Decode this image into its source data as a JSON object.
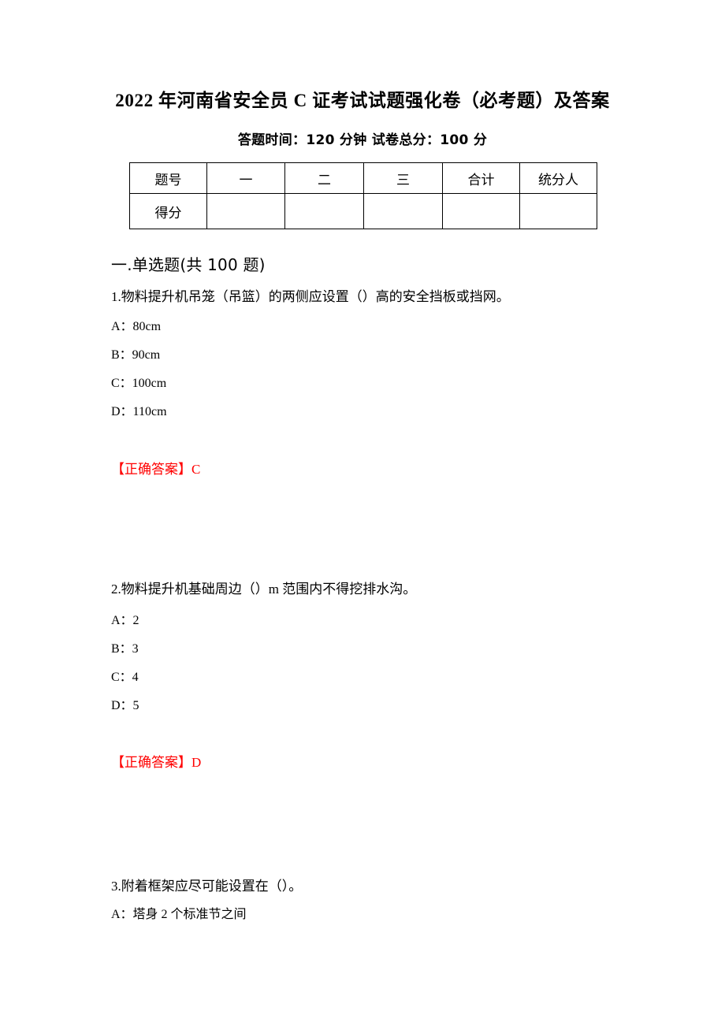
{
  "document": {
    "title": "2022 年河南省安全员 C 证考试试题强化卷（必考题）及答案",
    "subtitle": "答题时间：120 分钟    试卷总分：100 分"
  },
  "score_table": {
    "row_labels": [
      "题号",
      "得分"
    ],
    "columns": [
      "一",
      "二",
      "三",
      "合计",
      "统分人"
    ],
    "score_values": [
      "",
      "",
      "",
      "",
      ""
    ]
  },
  "section": {
    "heading": "一.单选题(共 100 题)"
  },
  "answer_label": "【正确答案】",
  "answer_color": "#FF0000",
  "questions": [
    {
      "stem": "1.物料提升机吊笼（吊篮）的两侧应设置（）高的安全挡板或挡网。",
      "options": [
        "A：80cm",
        "B：90cm",
        "C：100cm",
        "D：110cm"
      ],
      "answer": "C"
    },
    {
      "stem": "2.物料提升机基础周边（）m 范围内不得挖排水沟。",
      "options": [
        "A：2",
        "B：3",
        "C：4",
        "D：5"
      ],
      "answer": "D"
    },
    {
      "stem": "3.附着框架应尽可能设置在（）。",
      "options": [
        "A：塔身 2 个标准节之间"
      ],
      "answer": ""
    }
  ]
}
